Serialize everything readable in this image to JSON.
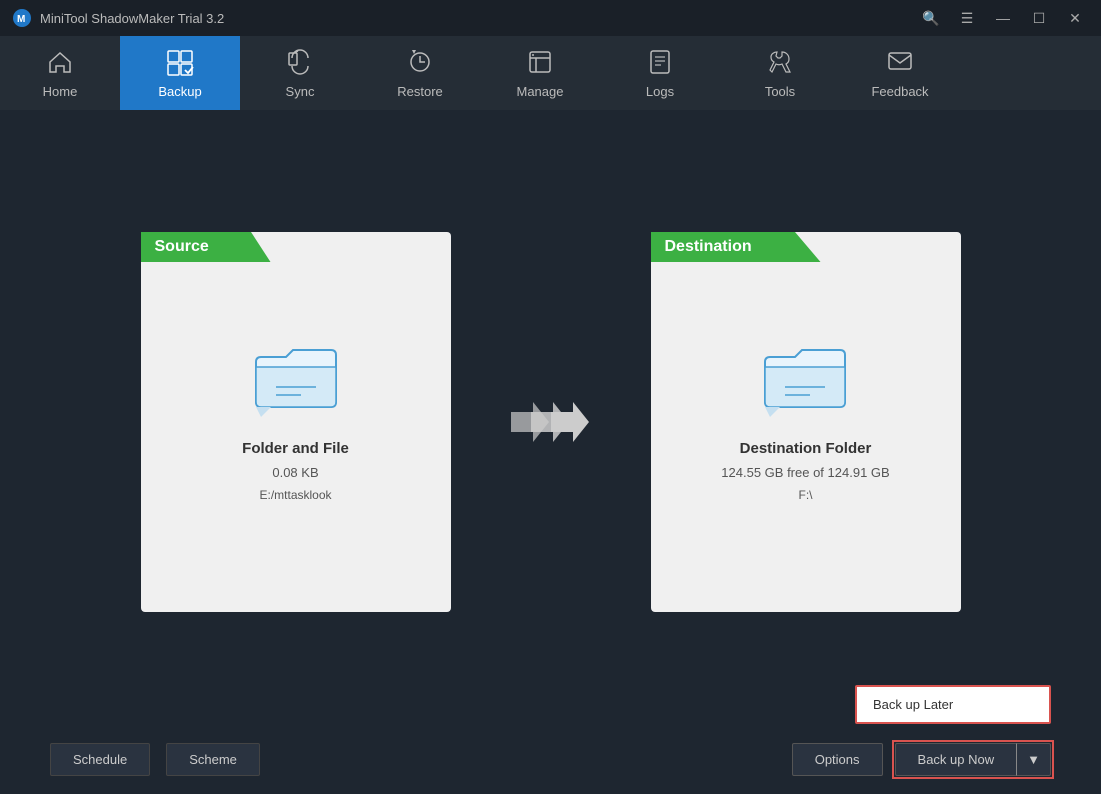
{
  "titleBar": {
    "title": "MiniTool ShadowMaker Trial 3.2",
    "controls": {
      "search": "🔍",
      "menu": "☰",
      "minimize": "—",
      "maximize": "☐",
      "close": "✕"
    }
  },
  "nav": {
    "items": [
      {
        "id": "home",
        "label": "Home",
        "icon": "home"
      },
      {
        "id": "backup",
        "label": "Backup",
        "icon": "backup",
        "active": true
      },
      {
        "id": "sync",
        "label": "Sync",
        "icon": "sync"
      },
      {
        "id": "restore",
        "label": "Restore",
        "icon": "restore"
      },
      {
        "id": "manage",
        "label": "Manage",
        "icon": "manage"
      },
      {
        "id": "logs",
        "label": "Logs",
        "icon": "logs"
      },
      {
        "id": "tools",
        "label": "Tools",
        "icon": "tools"
      },
      {
        "id": "feedback",
        "label": "Feedback",
        "icon": "feedback"
      }
    ]
  },
  "source": {
    "header": "Source",
    "title": "Folder and File",
    "size": "0.08 KB",
    "path": "E:/mttasklook"
  },
  "destination": {
    "header": "Destination",
    "title": "Destination Folder",
    "free": "124.55 GB free of 124.91 GB",
    "path": "F:\\"
  },
  "bottomBar": {
    "schedule": "Schedule",
    "scheme": "Scheme",
    "options": "Options",
    "backupNow": "Back up Now",
    "backupLater": "Back up Later"
  }
}
